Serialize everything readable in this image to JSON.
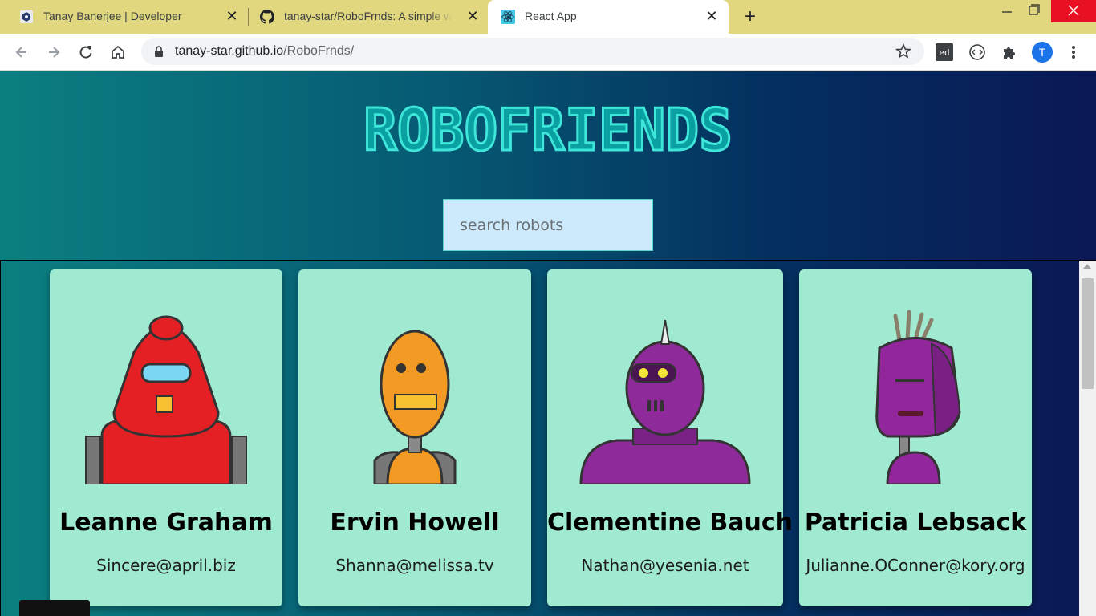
{
  "browser": {
    "tabs": [
      {
        "title": "Tanay Banerjee | Developer",
        "icon": "hexagon-icon"
      },
      {
        "title": "tanay-star/RoboFrnds: A simple web app",
        "icon": "github-icon"
      },
      {
        "title": "React App",
        "icon": "react-icon",
        "active": true
      }
    ],
    "new_tab": "+",
    "url_host": "tanay-star.github.io",
    "url_path": "/RoboFrnds/",
    "extensions": [
      "ed",
      "code-icon",
      "puzzle-icon"
    ],
    "profile_initial": "T"
  },
  "app": {
    "title": "ROBOFRIENDS",
    "search_placeholder": "search robots",
    "robots": [
      {
        "name": "Leanne Graham",
        "email": "Sincere@april.biz",
        "color": "#e52025"
      },
      {
        "name": "Ervin Howell",
        "email": "Shanna@melissa.tv",
        "color": "#f39a24"
      },
      {
        "name": "Clementine Bauch",
        "email": "Nathan@yesenia.net",
        "color": "#8e2a9a"
      },
      {
        "name": "Patricia Lebsack",
        "email": "Julianne.OConner@kory.org",
        "color": "#92279c"
      }
    ]
  },
  "colors": {
    "card_bg": "#a0ead1",
    "title_fill": "#0a9fa0",
    "title_stroke": "#3ee6d9",
    "search_bg": "#cdeafc"
  }
}
